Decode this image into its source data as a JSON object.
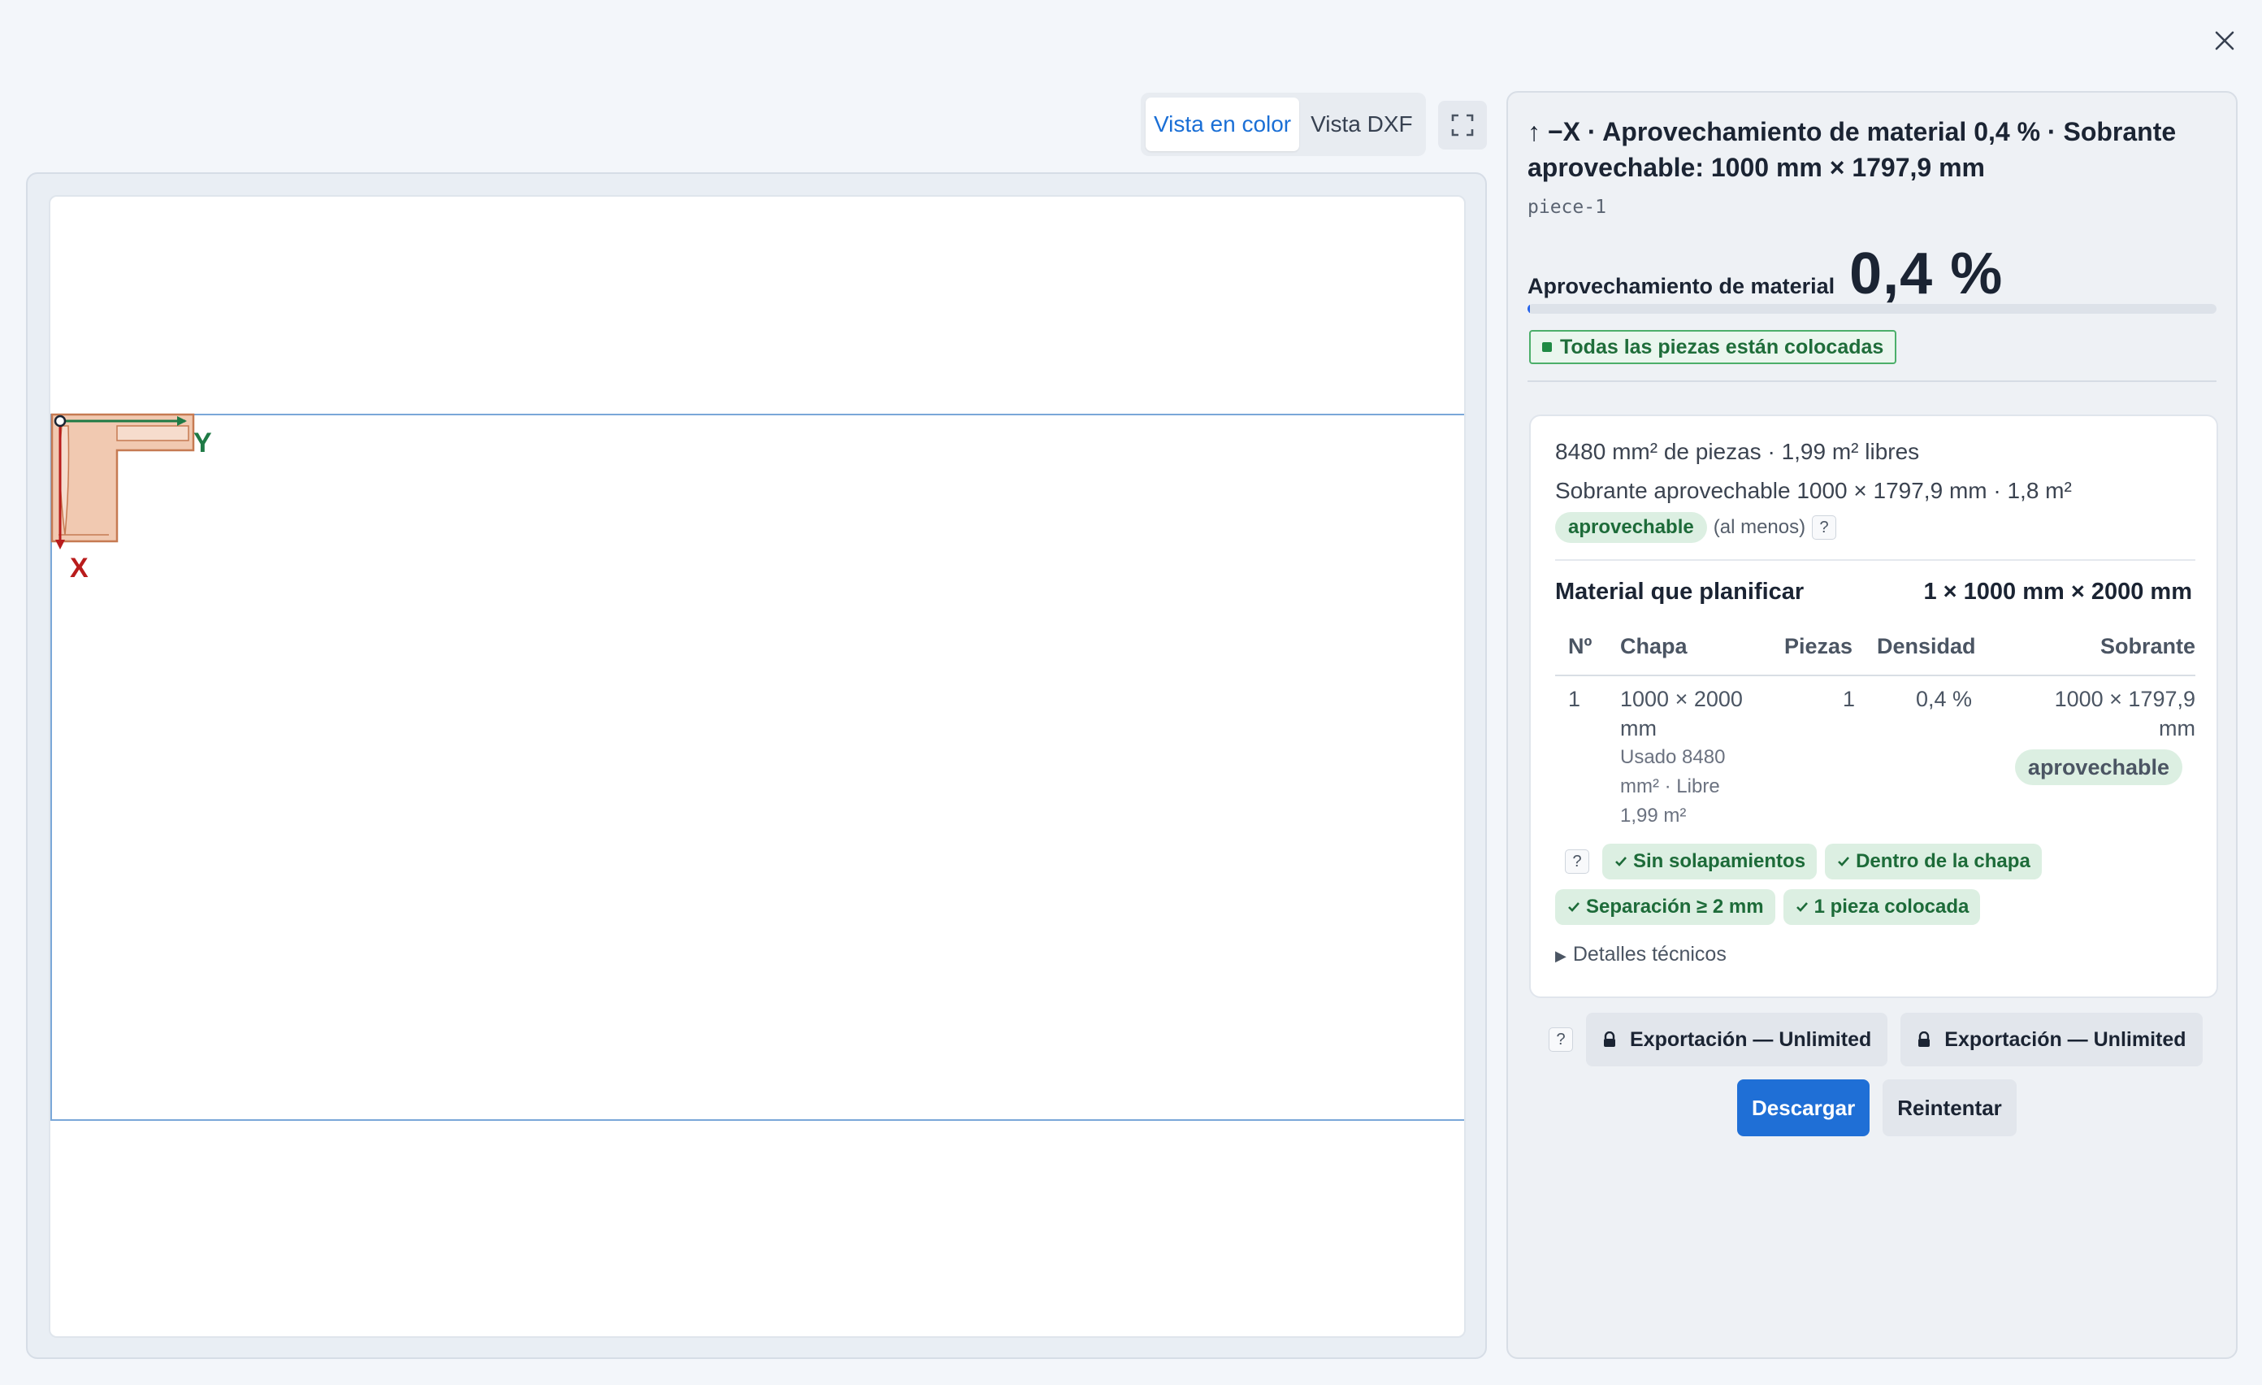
{
  "close": {
    "icon": "close-icon"
  },
  "view_toggle": {
    "color_label": "Vista en color",
    "dxf_label": "Vista DXF",
    "active": "color"
  },
  "fullscreen": {
    "icon": "fullscreen-icon"
  },
  "canvas": {
    "axis_x_label": "X",
    "axis_y_label": "Y",
    "sheet_color": "#7aa7d8",
    "piece_fill": "#f1c9b1",
    "piece_stroke": "#c67a52",
    "x_axis_color": "#b91c1c",
    "y_axis_color": "#1e7a45"
  },
  "side": {
    "title": "↑ −X · Aprovechamiento de material 0,4 % · Sobrante aprovechable: 1000 mm × 1797,9 mm",
    "piece_id": "piece-1",
    "utilization_label": "Aprovechamiento de material",
    "utilization_value": "0,4 %",
    "utilization_fraction": 0.004,
    "status_text": "Todas las piezas están colocadas",
    "summary_line1": "8480 mm² de piezas · 1,99 m² libres",
    "summary_line2": "Sobrante aprovechable 1000 × 1797,9 mm · 1,8 m²",
    "tag_reusable": "aprovechable",
    "at_least": "(al menos)",
    "help": "?",
    "material_label": "Material que planificar",
    "material_value": "1 × 1000 mm × 2000 mm",
    "table": {
      "headers": {
        "no": "Nº",
        "sheet": "Chapa",
        "pieces": "Piezas",
        "density": "Densidad",
        "remnant": "Sobrante"
      },
      "rows": [
        {
          "no": "1",
          "sheet_l1": "1000 × 2000",
          "sheet_l2": "mm",
          "used_l1": "Usado 8480",
          "used_l2": "mm² · Libre",
          "used_l3": "1,99 m²",
          "pieces": "1",
          "density": "0,4 %",
          "remnant_l1": "1000 × 1797,9",
          "remnant_l2": "mm",
          "remnant_tag": "aprovechable"
        }
      ]
    },
    "checks": [
      "Sin solapamientos",
      "Dentro de la chapa",
      "Separación ≥ 2 mm",
      "1 pieza colocada"
    ],
    "details_label": "Detalles técnicos",
    "export_buttons": [
      "Exportación — Unlimited",
      "Exportación — Unlimited"
    ],
    "download_label": "Descargar",
    "retry_label": "Reintentar"
  }
}
